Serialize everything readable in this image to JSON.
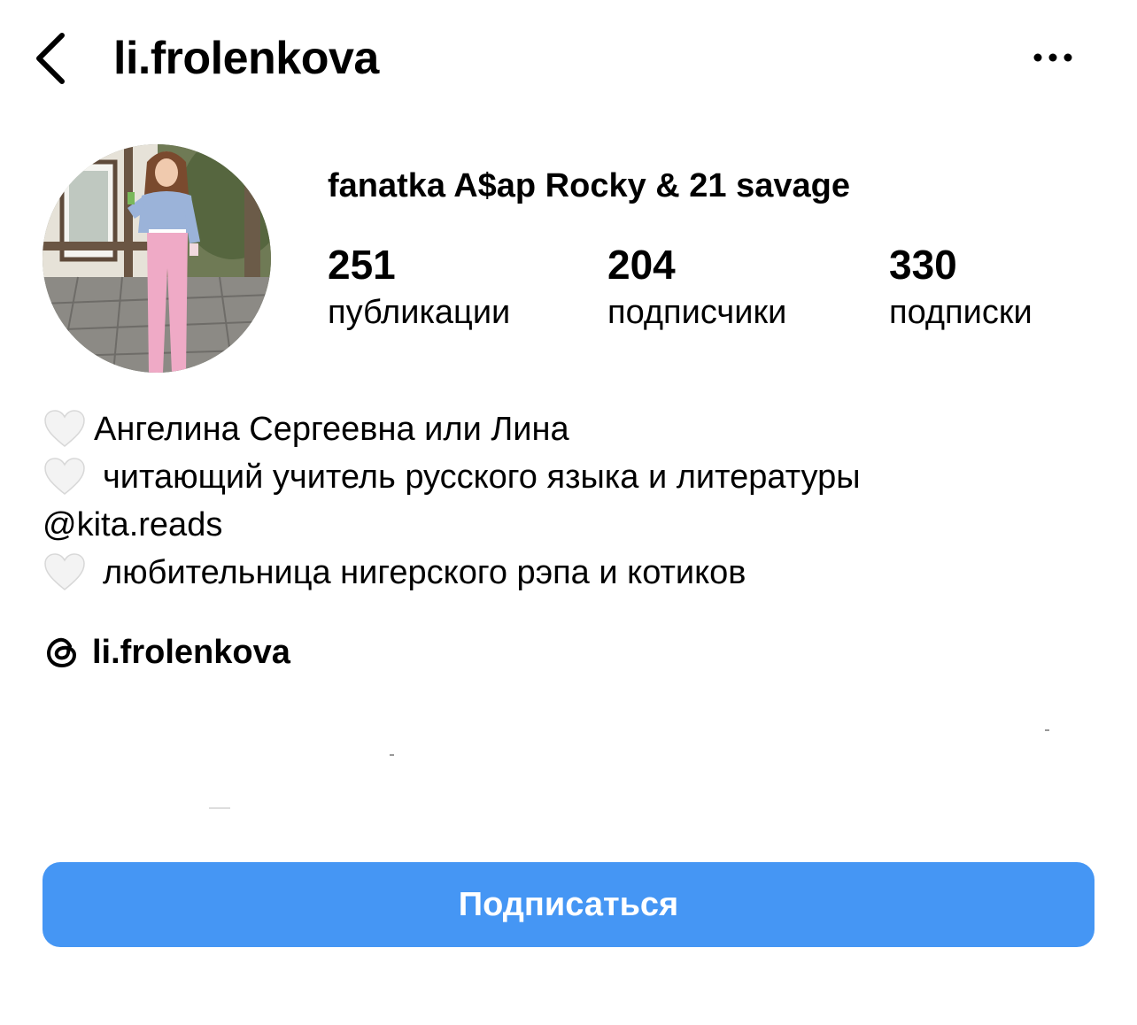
{
  "header": {
    "username": "li.frolenkova"
  },
  "profile": {
    "display_name": "fanatka A$ap Rocky & 21 savage",
    "stats": [
      {
        "value": "251",
        "label": "публикации"
      },
      {
        "value": "204",
        "label": "подписчики"
      },
      {
        "value": "330",
        "label": "подписки"
      }
    ]
  },
  "bio": {
    "line1": "Ангелина Сергеевна или Лина",
    "line2": "читающий учитель русского языка и литературы",
    "mention": "@kita.reads",
    "line4": "любительница нигерского рэпа и котиков"
  },
  "threads": {
    "handle": "li.frolenkova"
  },
  "actions": {
    "follow_label": "Подписаться"
  },
  "colors": {
    "accent": "#4596f4"
  }
}
